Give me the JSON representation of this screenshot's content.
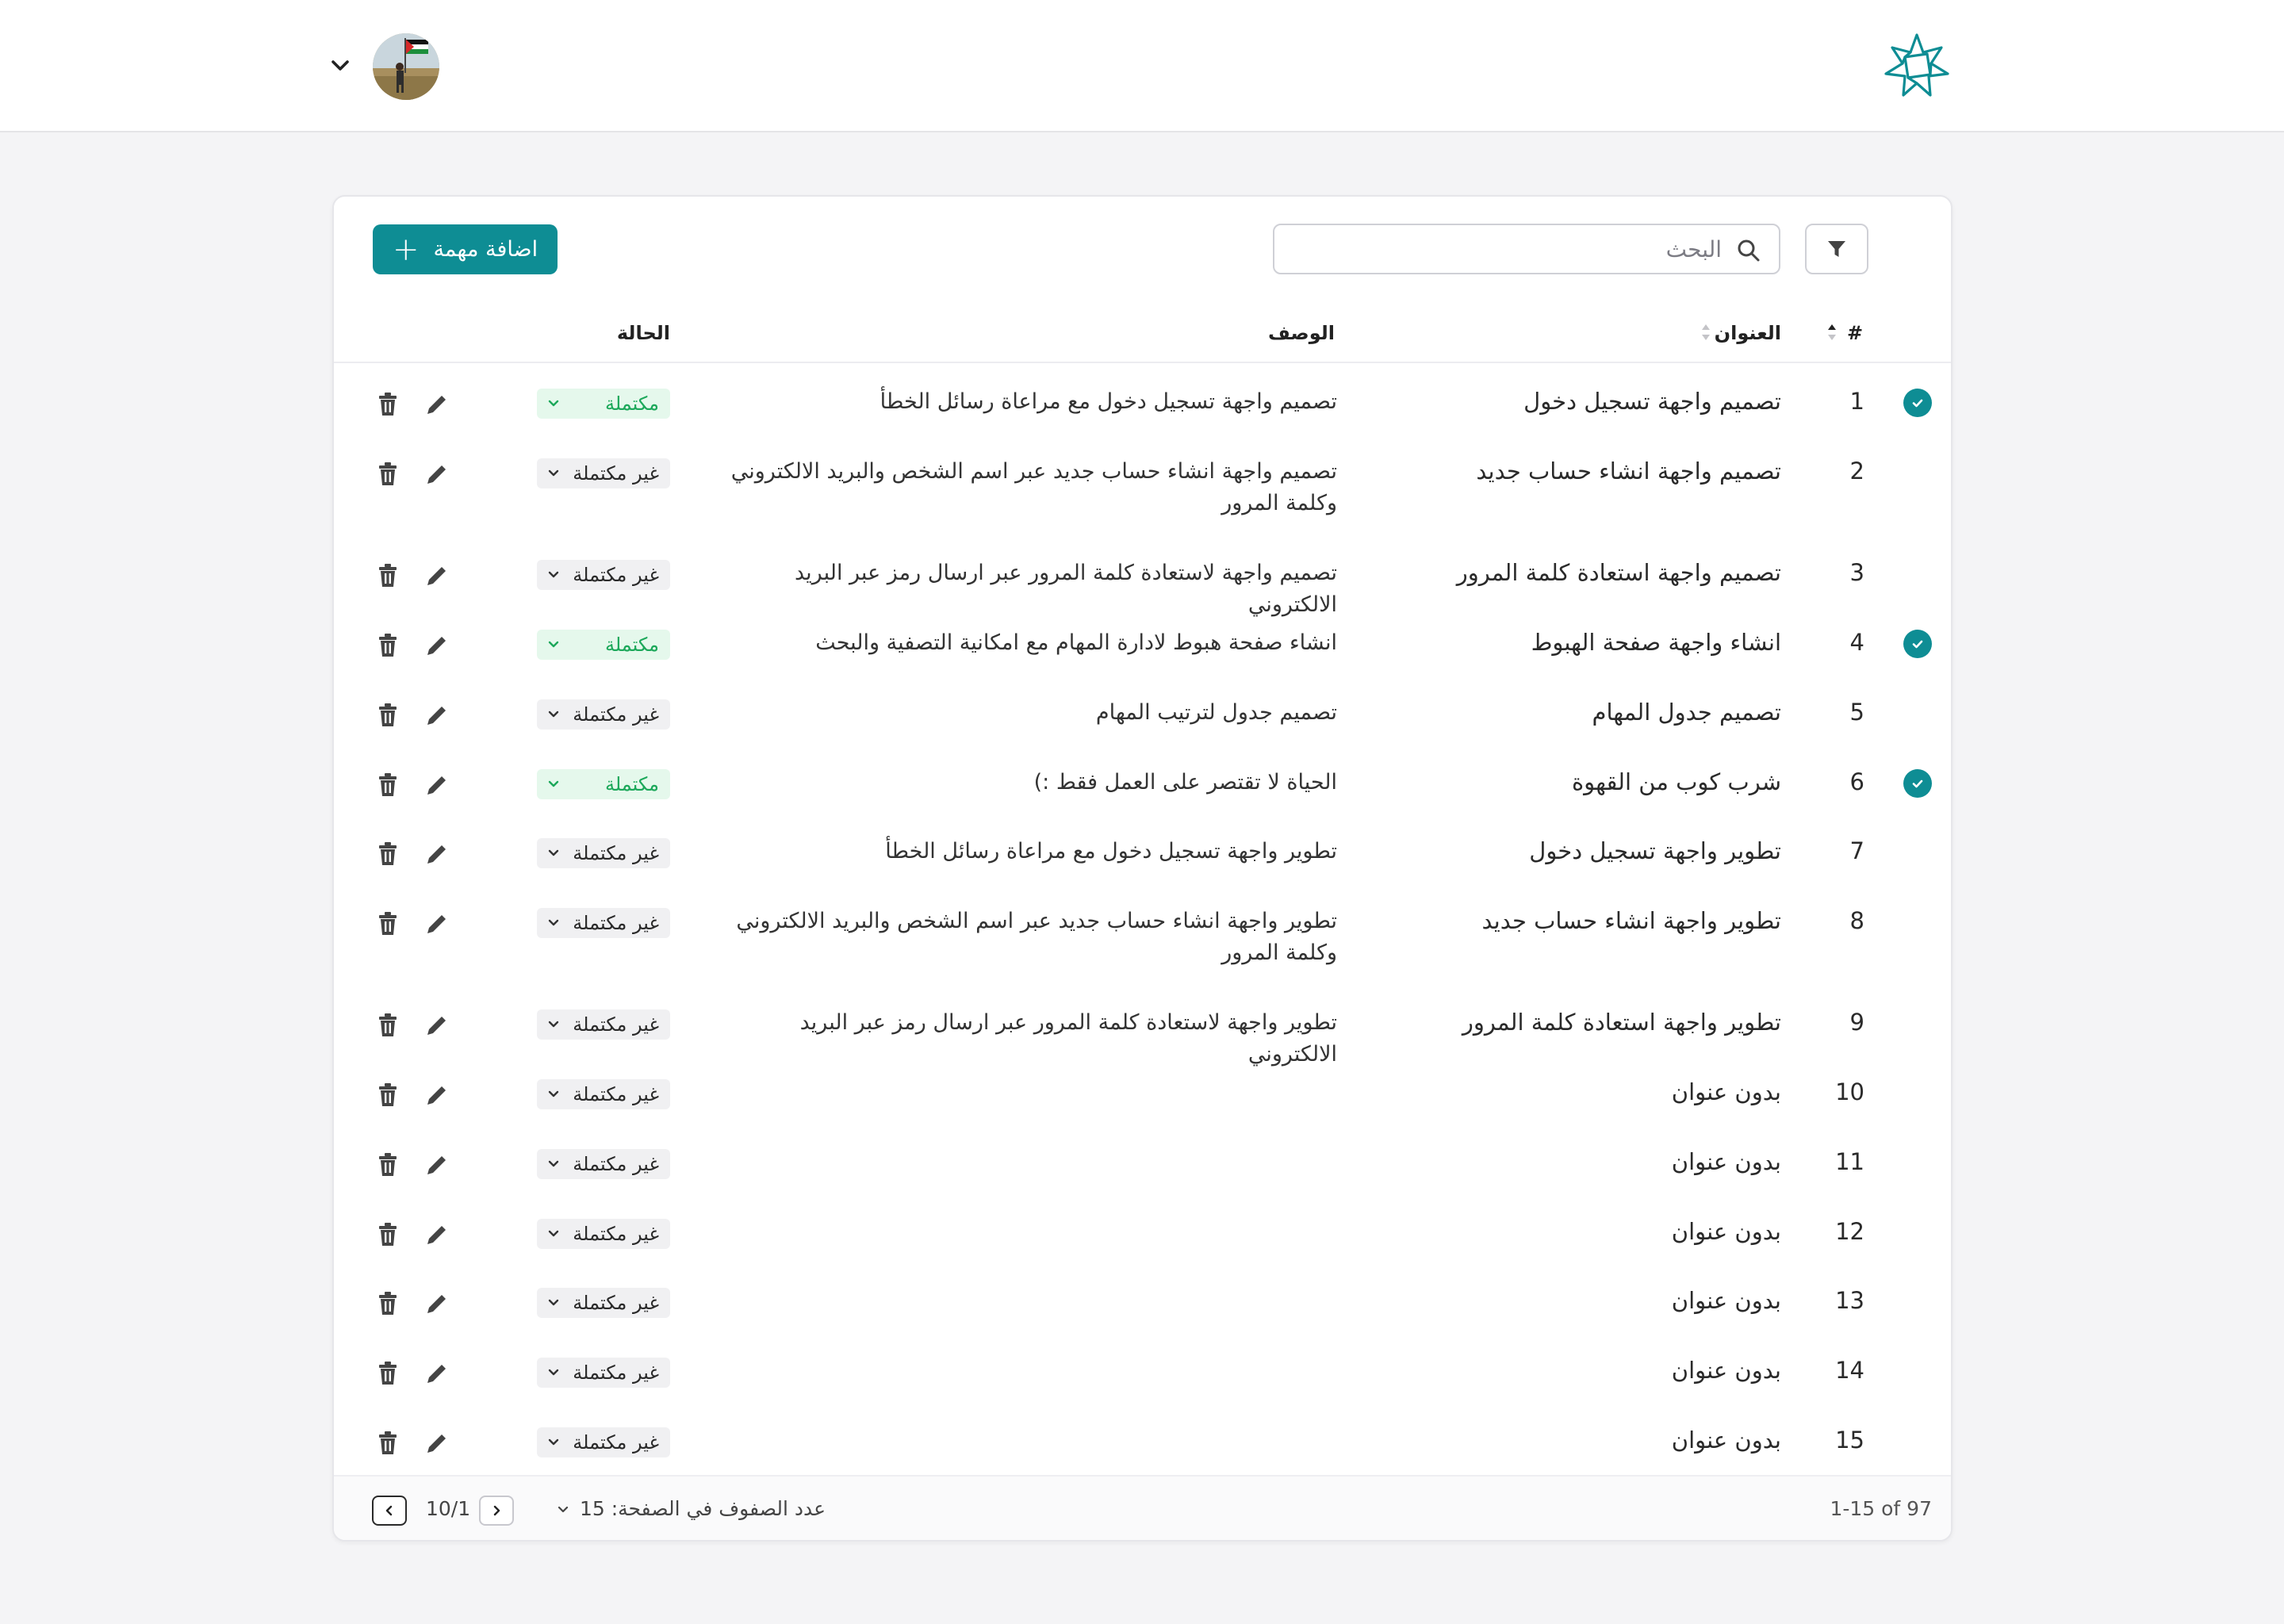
{
  "header": {
    "logo_icon": "star-knot-logo-icon",
    "avatar_icon": "user-avatar-icon",
    "menu_icon": "chevron-down-icon"
  },
  "toolbar": {
    "add_label": "اضافة مهمة",
    "search_placeholder": "البحث",
    "accent_color": "#0e8d94"
  },
  "table": {
    "columns": {
      "number": "#",
      "title": "العنوان",
      "description": "الوصف",
      "status": "الحالة"
    },
    "rows": [
      {
        "checked": true,
        "number": "1",
        "title": "تصميم واجهة تسجيل دخول",
        "description": "تصميم واجهة تسجيل دخول مع مراعاة رسائل الخطأ",
        "status": "مكتملة",
        "done": true
      },
      {
        "checked": false,
        "number": "2",
        "title": "تصميم واجهة انشاء حساب جديد",
        "description": "تصميم واجهة انشاء حساب جديد عبر اسم الشخص والبريد الالكتروني وكلمة المرور",
        "status": "غير مكتملة",
        "done": false
      },
      {
        "checked": false,
        "number": "3",
        "title": "تصميم واجهة استعادة كلمة المرور",
        "description": "تصميم واجهة لاستعادة كلمة المرور عبر ارسال رمز عبر البريد الالكتروني",
        "status": "غير مكتملة",
        "done": false
      },
      {
        "checked": true,
        "number": "4",
        "title": "انشاء واجهة صفحة الهبوط",
        "description": "انشاء صفحة هبوط لادارة المهام مع امكانية التصفية والبحث",
        "status": "مكتملة",
        "done": true
      },
      {
        "checked": false,
        "number": "5",
        "title": "تصميم جدول المهام",
        "description": "تصميم جدول لترتيب المهام",
        "status": "غير مكتملة",
        "done": false
      },
      {
        "checked": true,
        "number": "6",
        "title": "شرب كوب من القهوة",
        "description": "الحياة لا تقتصر على العمل فقط :)",
        "status": "مكتملة",
        "done": true
      },
      {
        "checked": false,
        "number": "7",
        "title": "تطوير واجهة تسجيل دخول",
        "description": "تطوير واجهة تسجيل دخول مع مراعاة رسائل الخطأ",
        "status": "غير مكتملة",
        "done": false
      },
      {
        "checked": false,
        "number": "8",
        "title": "تطوير واجهة انشاء حساب جديد",
        "description": "تطوير واجهة انشاء حساب جديد عبر اسم الشخص والبريد الالكتروني وكلمة المرور",
        "status": "غير مكتملة",
        "done": false
      },
      {
        "checked": false,
        "number": "9",
        "title": "تطوير واجهة استعادة كلمة المرور",
        "description": "تطوير واجهة لاستعادة كلمة المرور عبر ارسال رمز عبر البريد الالكتروني",
        "status": "غير مكتملة",
        "done": false
      },
      {
        "checked": false,
        "number": "10",
        "title": "بدون عنوان",
        "description": "",
        "status": "غير مكتملة",
        "done": false
      },
      {
        "checked": false,
        "number": "11",
        "title": "بدون عنوان",
        "description": "",
        "status": "غير مكتملة",
        "done": false
      },
      {
        "checked": false,
        "number": "12",
        "title": "بدون عنوان",
        "description": "",
        "status": "غير مكتملة",
        "done": false
      },
      {
        "checked": false,
        "number": "13",
        "title": "بدون عنوان",
        "description": "",
        "status": "غير مكتملة",
        "done": false
      },
      {
        "checked": false,
        "number": "14",
        "title": "بدون عنوان",
        "description": "",
        "status": "غير مكتملة",
        "done": false
      },
      {
        "checked": false,
        "number": "15",
        "title": "بدون عنوان",
        "description": "",
        "status": "غير مكتملة",
        "done": false
      }
    ]
  },
  "footer": {
    "range": "1-15 of 97",
    "rows_per_page_label": "عدد الصفوف في الصفحة:",
    "rows_per_page_value": "15",
    "page_indicator": "10/1"
  }
}
